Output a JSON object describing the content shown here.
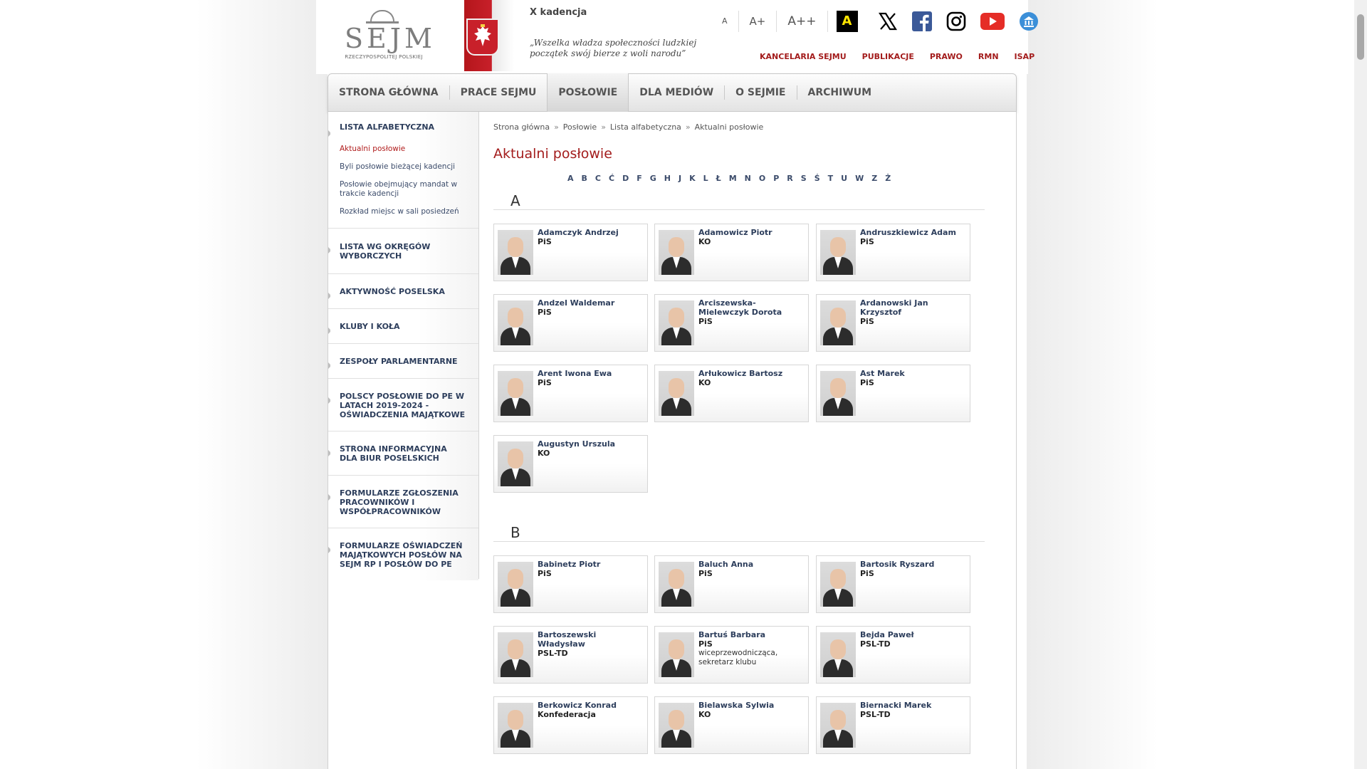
{
  "header": {
    "logo_text": "SEJM",
    "logo_sub": "RZECZYPOSPOLITEJ POLSKIEJ",
    "kadencja": "X kadencja",
    "quote": "„Wszelka władza społeczności ludzkiej początek swój bierze z woli narodu”",
    "font_sizes": [
      "A",
      "A+",
      "A++"
    ],
    "contrast_label": "A",
    "social_icons": [
      "x-icon",
      "facebook-icon",
      "instagram-icon",
      "youtube-icon",
      "bip-icon"
    ],
    "topnav": [
      "KANCELARIA SEJMU",
      "PUBLIKACJE",
      "PRAWO",
      "RMN",
      "ISAP"
    ]
  },
  "mainnav": {
    "items": [
      "STRONA GŁÓWNA",
      "PRACE SEJMU",
      "POSŁOWIE",
      "DLA MEDIÓW",
      "O SEJMIE",
      "ARCHIWUM"
    ],
    "active": "POSŁOWIE"
  },
  "sidebar": {
    "sections": [
      {
        "title": "LISTA ALFABETYCZNA",
        "links": [
          "Aktualni posłowie",
          "Byli posłowie bieżącej kadencji",
          "Posłowie obejmujący mandat w trakcie kadencji",
          "Rozkład miejsc w sali posiedzeń"
        ]
      },
      {
        "title": "LISTA WG OKRĘGÓW WYBORCZYCH"
      },
      {
        "title": "AKTYWNOŚĆ POSELSKA"
      },
      {
        "title": "KLUBY I KOŁA"
      },
      {
        "title": "ZESPOŁY PARLAMENTARNE"
      },
      {
        "title": "POLSCY POSŁOWIE DO PE W LATACH 2019-2024 - OŚWIADCZENIA MAJĄTKOWE"
      },
      {
        "title": "STRONA INFORMACYJNA DLA BIUR POSELSKICH"
      },
      {
        "title": "FORMULARZE ZGŁOSZENIA PRACOWNIKÓW I WSPÓŁPRACOWNIKÓW"
      },
      {
        "title": "FORMULARZE OŚWIADCZEŃ MAJĄTKOWYCH POSŁÓW NA SEJM RP I POSŁÓW DO PE"
      }
    ]
  },
  "breadcrumb": [
    "Strona główna",
    "Posłowie",
    "Lista alfabetyczna",
    "Aktualni posłowie"
  ],
  "breadcrumb_sep": "»",
  "page_title": "Aktualni posłowie",
  "alphabet": [
    "A",
    "B",
    "C",
    "Ć",
    "D",
    "F",
    "G",
    "H",
    "J",
    "K",
    "L",
    "Ł",
    "M",
    "N",
    "O",
    "P",
    "R",
    "S",
    "Ś",
    "T",
    "U",
    "W",
    "Z",
    "Ż"
  ],
  "groups": [
    {
      "letter": "A",
      "members": [
        {
          "name": "Adamczyk Andrzej",
          "party": "PiS"
        },
        {
          "name": "Adamowicz Piotr",
          "party": "KO"
        },
        {
          "name": "Andruszkiewicz Adam",
          "party": "PiS"
        },
        {
          "name": "Andzel Waldemar",
          "party": "PiS"
        },
        {
          "name": "Arciszewska-Mielewczyk Dorota",
          "party": "PiS"
        },
        {
          "name": "Ardanowski Jan Krzysztof",
          "party": "PiS"
        },
        {
          "name": "Arent Iwona Ewa",
          "party": "PiS"
        },
        {
          "name": "Arłukowicz Bartosz",
          "party": "KO"
        },
        {
          "name": "Ast Marek",
          "party": "PiS"
        },
        {
          "name": "Augustyn Urszula",
          "party": "KO"
        }
      ]
    },
    {
      "letter": "B",
      "members": [
        {
          "name": "Babinetz Piotr",
          "party": "PiS"
        },
        {
          "name": "Baluch Anna",
          "party": "PiS"
        },
        {
          "name": "Bartosik Ryszard",
          "party": "PiS"
        },
        {
          "name": "Bartoszewski Władysław",
          "party": "PSL-TD"
        },
        {
          "name": "Bartuś Barbara",
          "party": "PiS",
          "role": "wiceprzewodnicząca, sekretarz klubu"
        },
        {
          "name": "Bejda Paweł",
          "party": "PSL-TD"
        },
        {
          "name": "Berkowicz Konrad",
          "party": "Konfederacja"
        },
        {
          "name": "Bielawska Sylwia",
          "party": "KO"
        },
        {
          "name": "Biernacki Marek",
          "party": "PSL-TD"
        }
      ]
    }
  ],
  "colors": {
    "accent_red": "#a31c1c",
    "link_navy": "#2d3e5c"
  }
}
